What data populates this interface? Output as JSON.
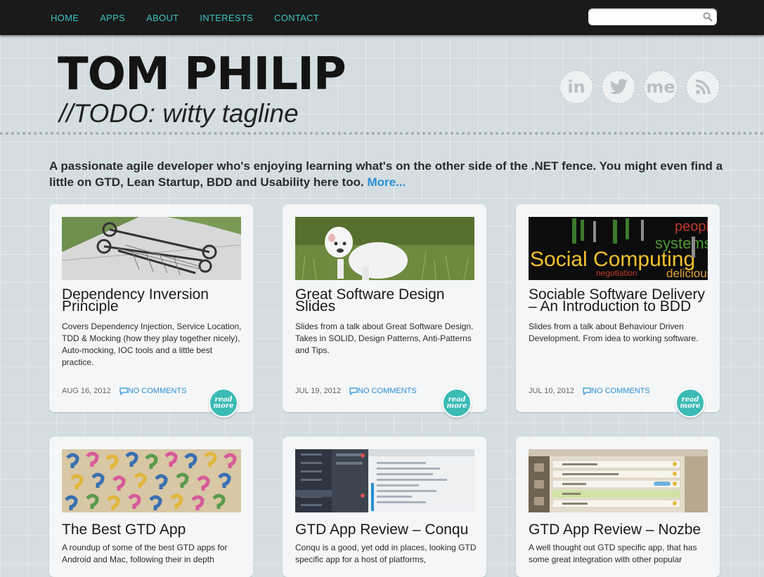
{
  "nav": {
    "items": [
      {
        "label": "HOME"
      },
      {
        "label": "APPS"
      },
      {
        "label": "ABOUT"
      },
      {
        "label": "INTERESTS"
      },
      {
        "label": "CONTACT"
      }
    ],
    "search_placeholder": "",
    "search_icon": "magnifier-icon"
  },
  "header": {
    "name": "TOM PHILIP",
    "tagline": "//TODO: witty tagline",
    "social": [
      {
        "icon": "linkedin-icon",
        "text": "in"
      },
      {
        "icon": "twitter-icon"
      },
      {
        "icon": "aboutme-icon",
        "text": "me"
      },
      {
        "icon": "rss-icon"
      }
    ]
  },
  "intro": {
    "text": "A passionate agile developer who's enjoying learning what's on the other side of the .NET fence. You might even find a little on GTD, Lean Startup, BDD and Usability here too.",
    "more": "More..."
  },
  "colors": {
    "nav_bg": "#1a1a1a",
    "nav_link": "#3cc3c3",
    "link_blue": "#2a8fd4",
    "read_more_badge": "#3bbbb5",
    "page_bg": "#d4dde1"
  },
  "posts": [
    {
      "title": "Dependency Inversion Principle",
      "excerpt": "Covers Dependency Injection, Service Location, TDD & Mocking (how they play together nicely), Auto-mocking, IOC tools and a little best practice.",
      "date": "AUG 16, 2012",
      "comments": "NO COMMENTS",
      "read_more": "read more",
      "image": "shopping-trolley-photo"
    },
    {
      "title": "Great Software Design Slides",
      "excerpt": "Slides from a talk about Great Software Design. Takes in SOLID, Design Patterns, Anti-Patterns and Tips.",
      "date": "JUL 19, 2012",
      "comments": "NO COMMENTS",
      "read_more": "read more",
      "image": "white-bulldog-photo"
    },
    {
      "title": "Sociable Software Delivery – An Introduction to BDD",
      "excerpt": "Slides from a talk about Behaviour Driven Development. From idea to working software.",
      "date": "JUL 10, 2012",
      "comments": "NO COMMENTS",
      "read_more": "read more",
      "image": "social-computing-word-cloud",
      "image_words": [
        "Social Computing",
        "systems",
        "people",
        "delicious",
        "negotiation"
      ]
    },
    {
      "title": "The Best GTD App",
      "excerpt": "A roundup of some of the best GTD apps for Android and Mac, following their in depth",
      "image": "question-mark-cookies-photo"
    },
    {
      "title": "GTD App Review – Conqu",
      "excerpt": "Conqu is a good, yet odd in places, looking GTD specific app for a host of platforms,",
      "image": "conqu-app-screenshot"
    },
    {
      "title": "GTD App Review – Nozbe",
      "excerpt": "A well thought out GTD specific app, that has some great integration with other popular",
      "image": "nozbe-app-screenshot"
    }
  ]
}
